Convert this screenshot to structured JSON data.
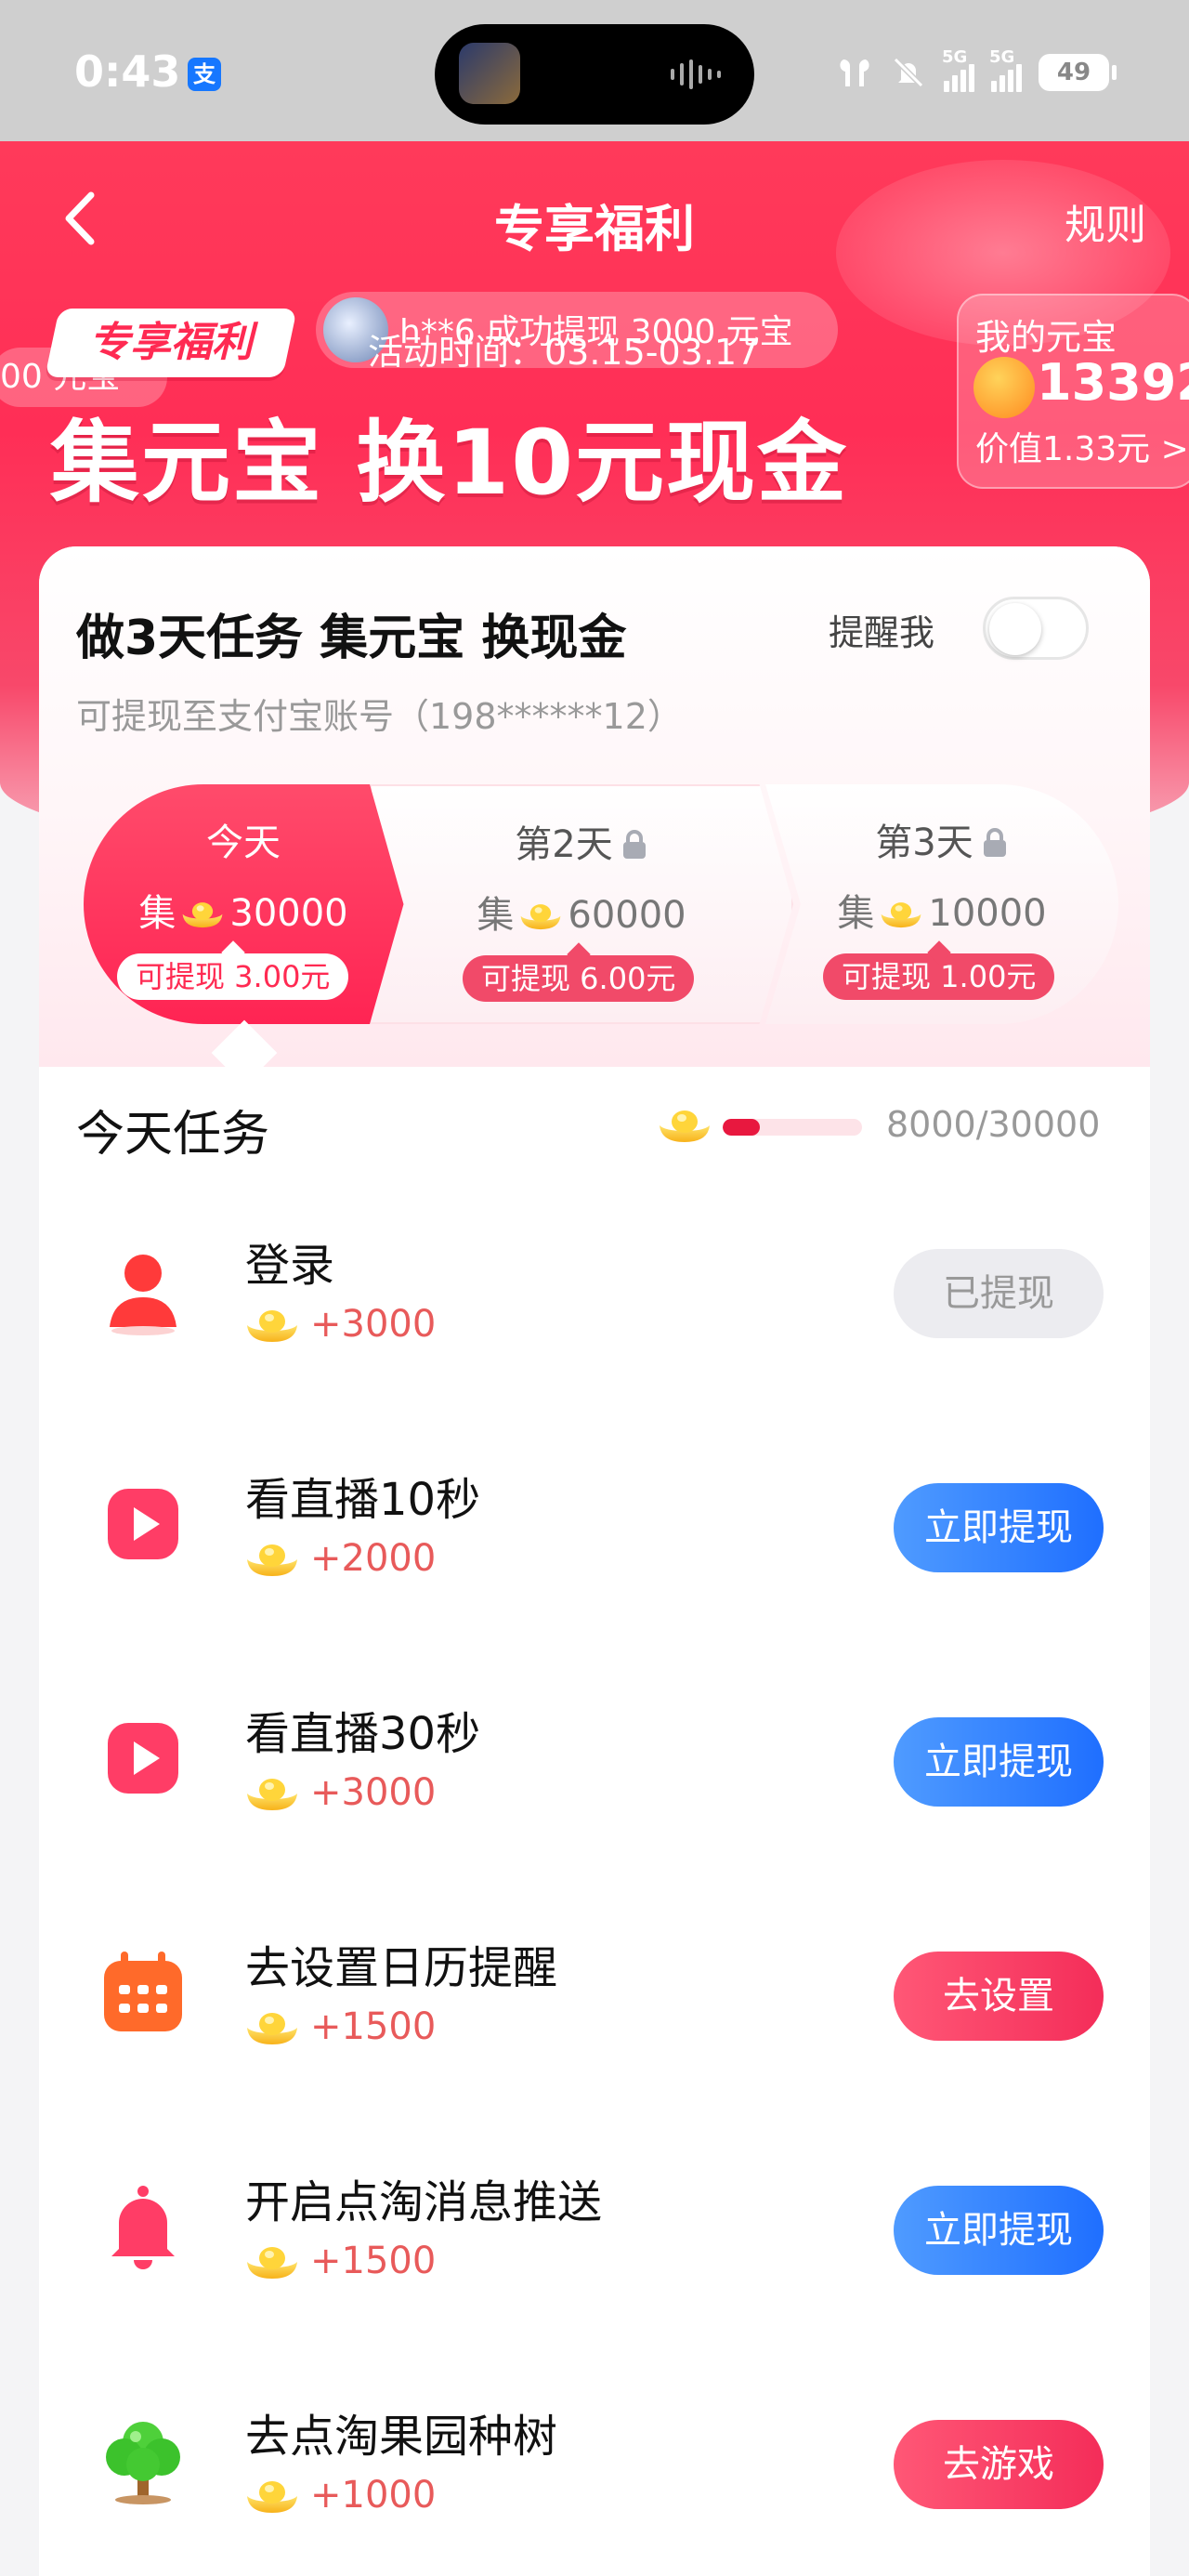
{
  "status_bar": {
    "time": "0:43",
    "app_badge": "支",
    "network_1": "5G",
    "network_2": "5G",
    "battery": "49"
  },
  "nav": {
    "title": "专享福利",
    "rules": "规则"
  },
  "hero": {
    "ticker_left": "00 元宝",
    "ticker": "h**6 成功提现 3000 元宝",
    "badge": "专享福利",
    "activity_time": "活动时间：03.15-03.17",
    "title": "集元宝 换10元现金",
    "my_coins_label": "我的元宝",
    "my_coins_value": "13392",
    "my_coins_worth": "价值1.33元 >"
  },
  "card": {
    "title": "做3天任务 集元宝 换现金",
    "remind_label": "提醒我",
    "remind_on": false,
    "subtitle": "可提现至支付宝账号（198******12）",
    "days": [
      {
        "label": "今天",
        "collect_prefix": "集",
        "amount": "30000",
        "pill": "可提现 3.00元",
        "locked": false
      },
      {
        "label": "第2天",
        "collect_prefix": "集",
        "amount": "60000",
        "pill": "可提现 6.00元",
        "locked": true
      },
      {
        "label": "第3天",
        "collect_prefix": "集",
        "amount": "10000",
        "pill": "可提现 1.00元",
        "locked": true
      }
    ]
  },
  "tasks": {
    "heading": "今天任务",
    "progress_text": "8000/30000",
    "progress_fraction": 0.267,
    "items": [
      {
        "title": "登录",
        "reward": "+3000",
        "button": "已提现",
        "icon": "person-icon"
      },
      {
        "title": "看直播10秒",
        "reward": "+2000",
        "button": "立即提现",
        "icon": "play-icon"
      },
      {
        "title": "看直播30秒",
        "reward": "+3000",
        "button": "立即提现",
        "icon": "play-icon"
      },
      {
        "title": "去设置日历提醒",
        "reward": "+1500",
        "button": "去设置",
        "icon": "calendar-icon"
      },
      {
        "title": "开启点淘消息推送",
        "reward": "+1500",
        "button": "立即提现",
        "icon": "bell-icon"
      },
      {
        "title": "去点淘果园种树",
        "reward": "+1000",
        "button": "去游戏",
        "icon": "tree-icon"
      }
    ]
  },
  "colors": {
    "brand_red": "#ff2e56",
    "button_blue": "#1f6fff",
    "reward_red": "#e85a5a"
  }
}
